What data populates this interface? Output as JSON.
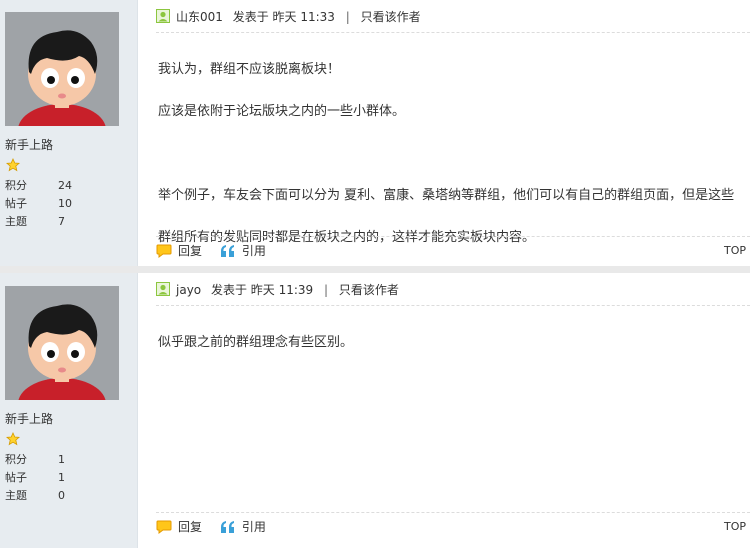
{
  "posts": [
    {
      "author": "山东001",
      "posted": "发表于 昨天 11:33",
      "only_author": "只看该作者",
      "content_lines": [
        "我认为，群组不应该脱离板块！",
        "应该是依附于论坛版块之内的一些小群体。",
        "",
        "举个例子，车友会下面可以分为 夏利、富康、桑塔纳等群组，他们可以有自己的群组页面，但是这些",
        "群组所有的发贴同时都是在板块之内的，这样才能充实板块内容。"
      ],
      "rank": "新手上路",
      "stats": [
        {
          "label": "积分",
          "value": "24"
        },
        {
          "label": "帖子",
          "value": "10"
        },
        {
          "label": "主题",
          "value": "7"
        }
      ],
      "reply": "回复",
      "quote": "引用",
      "top": "TOP"
    },
    {
      "author": "jayo",
      "posted": "发表于 昨天 11:39",
      "only_author": "只看该作者",
      "content_lines": [
        "似乎跟之前的群组理念有些区别。"
      ],
      "rank": "新手上路",
      "stats": [
        {
          "label": "积分",
          "value": "1"
        },
        {
          "label": "帖子",
          "value": "1"
        },
        {
          "label": "主题",
          "value": "0"
        }
      ],
      "reply": "回复",
      "quote": "引用",
      "top": "TOP"
    }
  ],
  "colors": {
    "user_icon": "#8cc63f",
    "reply_icon": "#f5a300",
    "quote_icon": "#3aa0d8",
    "sidebar": "#e7ecf0"
  },
  "icons": [
    "user-icon",
    "reply-bubble-icon",
    "quote-icon",
    "star-icon",
    "avatar-cartoon"
  ]
}
